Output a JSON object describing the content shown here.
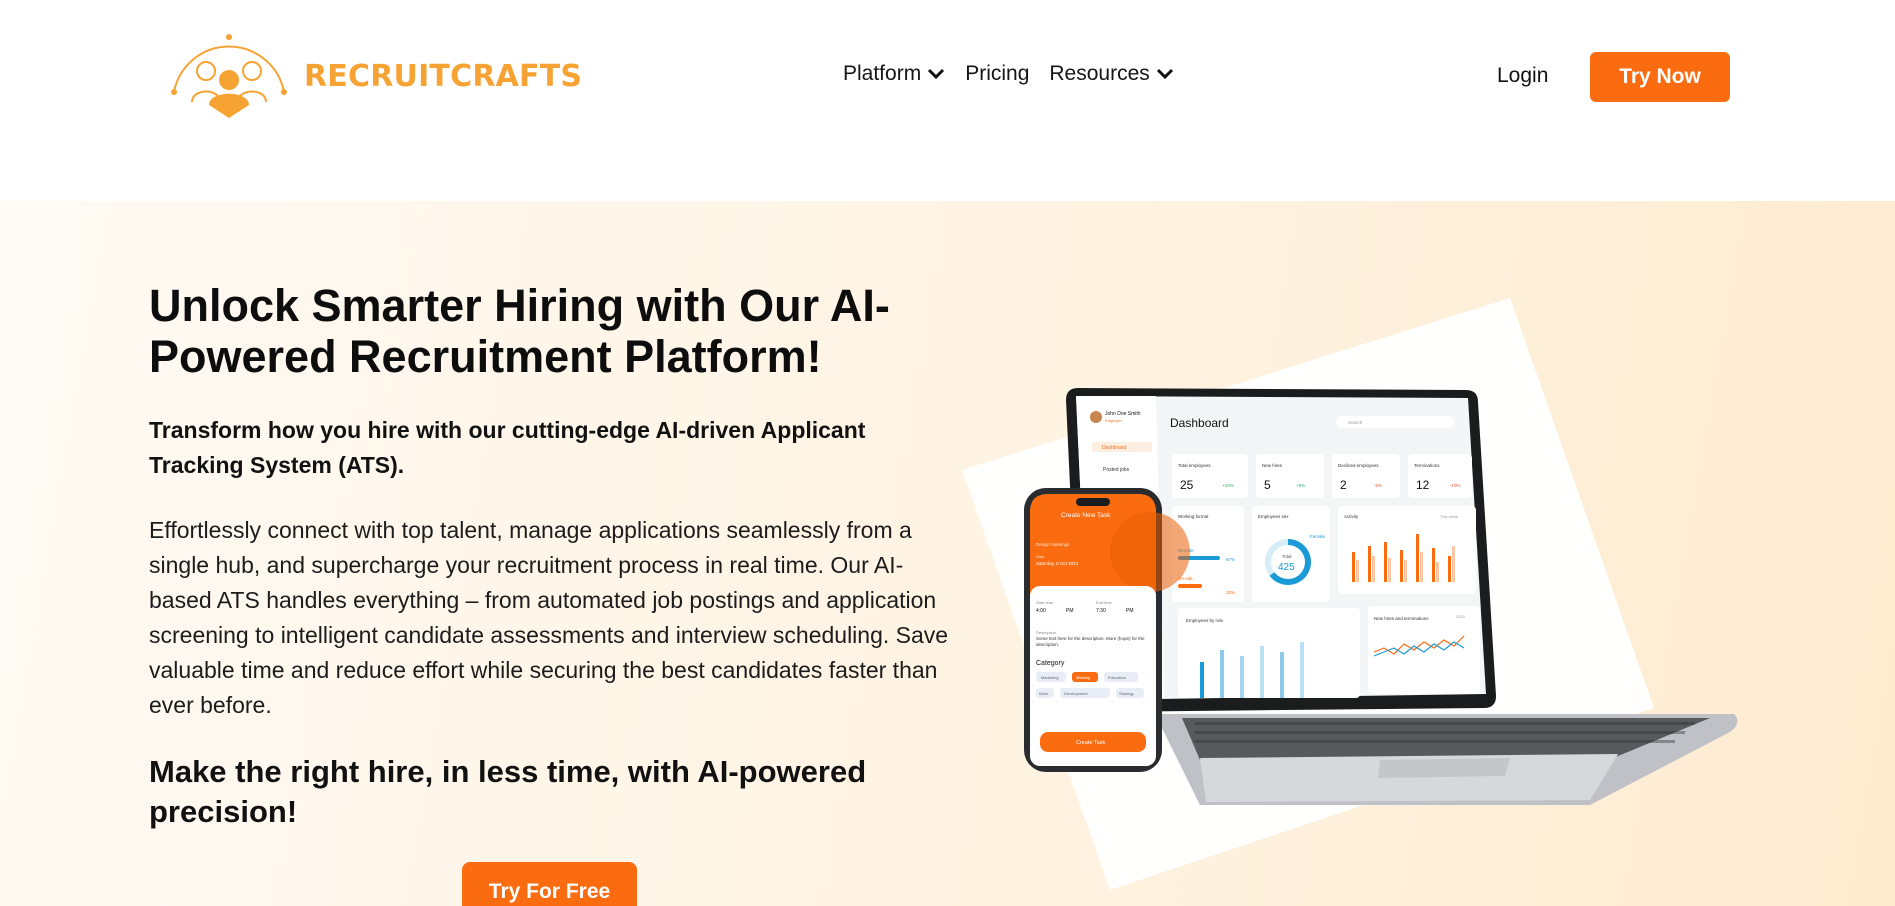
{
  "brand": {
    "name": "RECRUITCRAFTS",
    "color": "#f7a334",
    "accent": "#fb6b0f"
  },
  "nav": {
    "items": [
      {
        "label": "Platform",
        "has_dropdown": true
      },
      {
        "label": "Pricing",
        "has_dropdown": false
      },
      {
        "label": "Resources",
        "has_dropdown": true
      }
    ],
    "login_label": "Login",
    "cta_label": "Try Now"
  },
  "hero": {
    "title": "Unlock Smarter Hiring with Our AI-Powered Recruitment Platform!",
    "subtitle": "Transform how you hire with our cutting-edge AI-driven Applicant Tracking System (ATS).",
    "description": "Effortlessly connect with top talent, manage applications seamlessly from a single hub, and supercharge your recruitment process in real time. Our AI-based ATS handles everything – from automated job postings and application screening to intelligent candidate assessments and interview scheduling. Save valuable time and reduce effort while securing the best candidates faster than ever before.",
    "tagline": "Make the right hire, in less time, with AI-powered precision!",
    "cta_label": "Try For Free"
  },
  "mockup": {
    "dashboard": {
      "title": "Dashboard",
      "user_name": "John Doe Smith",
      "user_role": "Employer",
      "search_placeholder": "Search",
      "sidebar": [
        "Dashboard",
        "Posted jobs"
      ],
      "stats": [
        {
          "label": "Total employees",
          "value": "25",
          "change": "+10%"
        },
        {
          "label": "New hires",
          "value": "5",
          "change": "+5%"
        },
        {
          "label": "Declined employees",
          "value": "2",
          "change": "-5%"
        },
        {
          "label": "Terminations",
          "value": "12",
          "change": "-10%"
        }
      ],
      "panels": {
        "working_format": "Working format",
        "remote": "Remote",
        "remote_pct": "67%",
        "onsite": "On-site",
        "onsite_pct": "33%",
        "employees_sex": "Employees sex",
        "female": "Female",
        "total_label": "Total",
        "total_value": "425",
        "activity": "Activity",
        "this_week": "This week",
        "employees_by_role": "Employees by role",
        "new_hires_terminations": "New hires and terminations",
        "year": "2023"
      }
    },
    "phone": {
      "title": "Create New Task",
      "field_1": "Design Meetings",
      "date_label": "Date",
      "date": "Saturday, 8 Oct 2023",
      "start_label": "Start time",
      "start": "4:00",
      "start_ampm": "PM",
      "end_label": "End time",
      "end": "7:30",
      "end_ampm": "PM",
      "desc_label": "Description",
      "desc": "Some text here for the description. More (hope) for the description.",
      "category_label": "Category",
      "categories": [
        "Marketing",
        "Meeting",
        "Education",
        "Work",
        "Development",
        "Strategy"
      ],
      "button": "Create Task"
    }
  }
}
